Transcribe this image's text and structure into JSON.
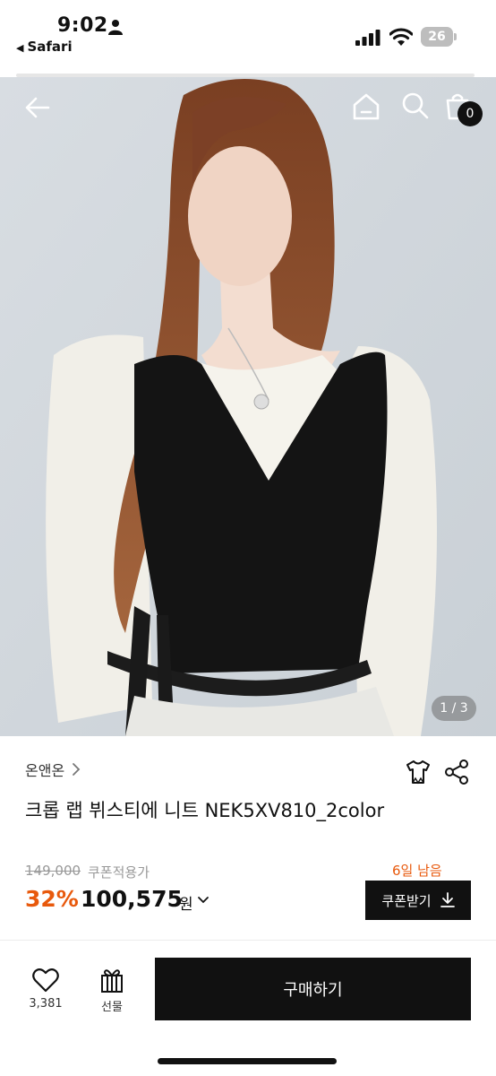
{
  "status_bar": {
    "time": "9:02",
    "back_app_label": "Safari",
    "battery_level": "26"
  },
  "header": {
    "cart_count": "0"
  },
  "gallery": {
    "page_indicator": "1 / 3"
  },
  "product": {
    "brand": "온앤온",
    "title": "크롭 랩 뷔스티에 니트 NEK5XV810_2color",
    "original_price": "149,000",
    "coupon_applied_label": "쿠폰적용가",
    "days_left": "6일 남음",
    "discount_rate": "32%",
    "sale_price": "100,575",
    "currency": "원",
    "coupon_button_label": "쿠폰받기"
  },
  "bottom_bar": {
    "like_count": "3,381",
    "gift_label": "선물",
    "buy_label": "구매하기"
  },
  "colors": {
    "accent_orange": "#e8590c",
    "primary_black": "#111111"
  },
  "icons": [
    "person-icon",
    "signal-icon",
    "wifi-icon",
    "battery-icon",
    "back-arrow-icon",
    "home-icon",
    "search-icon",
    "cart-icon",
    "chevron-right-icon",
    "tshirt-icon",
    "share-icon",
    "chevron-down-icon",
    "download-icon",
    "heart-icon",
    "gift-icon"
  ]
}
